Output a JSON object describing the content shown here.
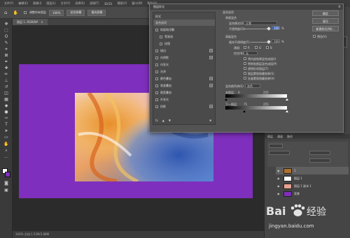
{
  "menu": [
    "文件(F)",
    "编辑(E)",
    "图像(I)",
    "图层(L)",
    "文字(Y)",
    "选择(S)",
    "滤镜(T)",
    "3D(D)",
    "视图(V)",
    "窗口(W)",
    "帮助(H)"
  ],
  "options": {
    "sample": "调整所有图层",
    "zoom": "100%",
    "fit": "适合屏幕",
    "fill": "填充屏幕"
  },
  "doc_tab": {
    "name": "图层 1, RGB/8#",
    "close": "×"
  },
  "status": "100%   文档:1.53M/3.88M",
  "dialog": {
    "title": "图层样式",
    "close": "×",
    "styles": [
      {
        "label": "样式",
        "check": false,
        "plus": false,
        "header": true
      },
      {
        "label": "混合选项",
        "check": false,
        "plus": false,
        "selected": true
      },
      {
        "label": "斜面和浮雕",
        "check": true,
        "plus": false
      },
      {
        "label": "等高线",
        "check": true,
        "plus": false,
        "indent": true
      },
      {
        "label": "纹理",
        "check": true,
        "plus": false,
        "indent": true
      },
      {
        "label": "描边",
        "check": true,
        "plus": true
      },
      {
        "label": "内阴影",
        "check": true,
        "plus": true
      },
      {
        "label": "内发光",
        "check": true,
        "plus": false
      },
      {
        "label": "光泽",
        "check": true,
        "plus": false
      },
      {
        "label": "颜色叠加",
        "check": true,
        "plus": true
      },
      {
        "label": "渐变叠加",
        "check": true,
        "plus": true
      },
      {
        "label": "图案叠加",
        "check": true,
        "plus": false
      },
      {
        "label": "外发光",
        "check": true,
        "plus": false
      },
      {
        "label": "投影",
        "check": true,
        "plus": true
      }
    ],
    "footer": [
      "fx",
      "▲",
      "▼",
      "🗑"
    ],
    "blend": {
      "section": "混合选项",
      "general": "常规混合",
      "mode_label": "混合模式(D):",
      "mode_value": "正常",
      "opacity_label": "不透明度(O):",
      "opacity_value": "100",
      "pct": "%",
      "advanced": "高级混合",
      "fill_label": "填充不透明度(F):",
      "fill_value": "100",
      "channels_label": "通道:",
      "channels": [
        "R",
        "G",
        "B"
      ],
      "knockout_label": "挖空(N):",
      "knockout_value": "无",
      "options": [
        "将内部效果混合成组(I)",
        "将剪贴图层混合成组(P)",
        "透明形状图层(T)",
        "图层蒙版隐藏效果(S)",
        "矢量蒙版隐藏效果(H)"
      ],
      "blendif_label": "混合颜色带(E):",
      "blendif_value": "灰色",
      "this_layer": "本图层:",
      "this_min": "0",
      "this_max": "255",
      "under_layer": "下一图层:",
      "under_min": "75",
      "under_max": "255"
    },
    "buttons": {
      "ok": "确定",
      "cancel": "复位",
      "new_style": "新建样式(W)...",
      "preview": "预览(V)"
    }
  },
  "layers_panel": {
    "tabs": [
      "图层",
      "通道",
      "路径"
    ],
    "layers": [
      {
        "name": "1",
        "thumb": "#b0702f",
        "selected": true
      },
      {
        "name": "图层 1",
        "thumb": "#ffffff"
      },
      {
        "name": "图层 1 副本 1",
        "thumb": "#e8a090"
      },
      {
        "name": "背景",
        "thumb": "#7e2fbd"
      }
    ],
    "footer_icons": [
      "link-icon",
      "fx-icon",
      "mask-icon",
      "adjust-icon",
      "folder-icon",
      "new-icon",
      "trash-icon"
    ]
  },
  "watermark": {
    "brand": "Bai经验",
    "url": "jingyan.baidu.com"
  },
  "colors": {
    "accent": "#7e2fbd",
    "canvas_bg": "#2b2b2b",
    "panel": "#454545"
  }
}
